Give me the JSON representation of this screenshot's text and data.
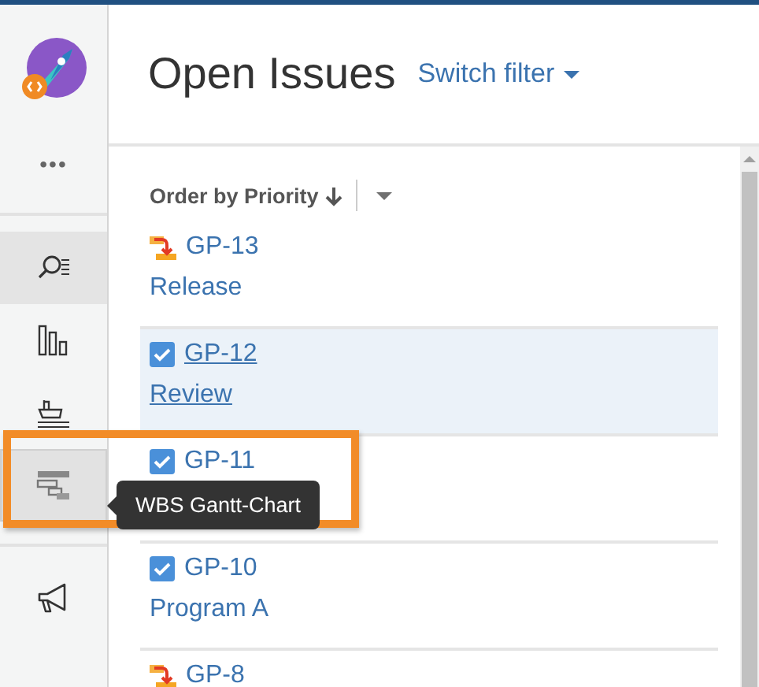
{
  "page": {
    "title": "Open Issues",
    "filter_link": "Switch filter"
  },
  "sidebar": {
    "more": "•••",
    "items": [
      {
        "kind": "search",
        "selected": true
      },
      {
        "kind": "board",
        "selected": false
      },
      {
        "kind": "ship",
        "selected": false
      },
      {
        "kind": "gantt",
        "selected": false,
        "hovered": true
      }
    ],
    "footer_items": [
      {
        "kind": "megaphone",
        "selected": false
      }
    ]
  },
  "tooltip": {
    "text": "WBS Gantt-Chart"
  },
  "sort": {
    "label": "Order by Priority"
  },
  "issues": [
    {
      "kind": "improvement",
      "key": "GP-13",
      "summary": "Release",
      "selected": false
    },
    {
      "kind": "task",
      "key": "GP-12",
      "summary": "Review",
      "selected": true
    },
    {
      "kind": "task",
      "key": "GP-11",
      "selected": false
    },
    {
      "kind": "task",
      "key": "GP-10",
      "summary": "Program A",
      "selected": false
    },
    {
      "kind": "improvement",
      "key": "GP-8",
      "selected": false
    }
  ]
}
